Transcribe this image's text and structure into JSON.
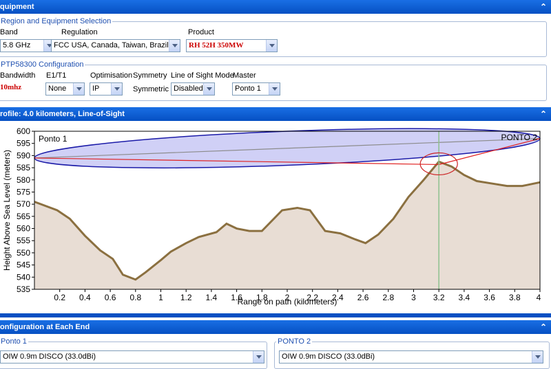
{
  "equipment": {
    "header": "quipment",
    "region_group_title": "Region and Equipment Selection",
    "band_label": "Band",
    "band_value": "5.8 GHz",
    "regulation_label": "Regulation",
    "regulation_value": "FCC USA, Canada, Taiwan, Brazil",
    "product_label": "Product",
    "product_value": "RH 52H 350MW",
    "config_group_title": "PTP58300 Configuration",
    "bandwidth_label": "Bandwidth",
    "bandwidth_value": "10mhz",
    "e1t1_label": "E1/T1",
    "e1t1_value": "None",
    "optimisation_label": "Optimisation",
    "optimisation_value": "IP",
    "symmetry_label": "Symmetry",
    "symmetry_value": "Symmetric",
    "los_mode_label": "Line of Sight Mode",
    "los_mode_value": "Disabled",
    "master_label": "Master",
    "master_value": "Ponto 1"
  },
  "profile": {
    "header": "rofile: 4.0 kilometers, Line-of-Sight"
  },
  "config_each_end": {
    "header": "onfiguration at Each End",
    "end1_title": "Ponto 1",
    "end1_antenna": "OIW 0.9m DISCO (33.0dBi)",
    "end2_title": "PONTO 2",
    "end2_antenna": "OIW 0.9m DISCO (33.0dBi)"
  },
  "chart_data": {
    "type": "area",
    "xlabel": "Range on path (kilometers)",
    "ylabel": "Height Above Sea Level (meters)",
    "xlim": [
      0,
      4
    ],
    "ylim": [
      535,
      600
    ],
    "x_ticks": [
      "0.2",
      "0.4",
      "0.6",
      "0.8",
      "1",
      "1.2",
      "1.4",
      "1.6",
      "1.8",
      "2",
      "2.2",
      "2.4",
      "2.6",
      "2.8",
      "3",
      "3.2",
      "3.4",
      "3.6",
      "3.8",
      "4"
    ],
    "y_ticks": [
      "535",
      "540",
      "545",
      "550",
      "555",
      "560",
      "565",
      "570",
      "575",
      "580",
      "585",
      "590",
      "595",
      "600"
    ],
    "left_site_label": "Ponto 1",
    "right_site_label": "PONTO 2",
    "terrain": {
      "x": [
        0,
        0.18,
        0.28,
        0.4,
        0.52,
        0.62,
        0.7,
        0.8,
        0.88,
        1.0,
        1.08,
        1.2,
        1.3,
        1.44,
        1.52,
        1.6,
        1.7,
        1.8,
        1.96,
        2.08,
        2.18,
        2.3,
        2.42,
        2.54,
        2.62,
        2.72,
        2.84,
        2.96,
        3.08,
        3.2,
        3.3,
        3.4,
        3.5,
        3.62,
        3.74,
        3.86,
        4.0
      ],
      "y": [
        571,
        567.5,
        564,
        557,
        551,
        547.5,
        541,
        539,
        542,
        547,
        550.5,
        554,
        556.5,
        558.5,
        562,
        560,
        559,
        559,
        567.5,
        568.5,
        567.5,
        559,
        558,
        555.5,
        554,
        557.5,
        564,
        573,
        580,
        587.5,
        585.5,
        582,
        579.5,
        578.5,
        577.5,
        577.5,
        579
      ]
    },
    "colors": {
      "terrain_fill": "#e8ddd4",
      "terrain_line": "#8b7040",
      "fresnel_fill": "#c8c8f4",
      "fresnel_line": "#1a1aa8",
      "los_line": "#8c8c8c",
      "obstruction_line": "#e02020",
      "obstruction_marker": "#cc2222",
      "marker_line": "#8ec08e"
    },
    "left_antenna_height": 589,
    "right_antenna_height": 597,
    "fresnel_halfwidth": 7,
    "obstruction_x": 3.2,
    "obstruction_y": 588
  }
}
